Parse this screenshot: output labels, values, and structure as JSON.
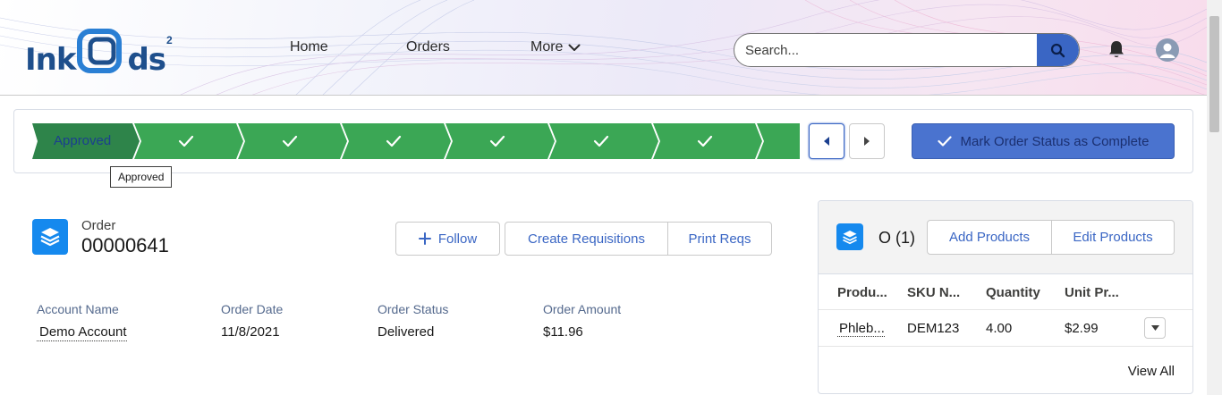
{
  "header": {
    "logo": {
      "text_left": "Ink",
      "text_right": "ds",
      "superscript": "2"
    },
    "nav": {
      "home": "Home",
      "orders": "Orders",
      "more": "More"
    },
    "search": {
      "placeholder": "Search..."
    },
    "icons": {
      "search": "search-icon",
      "bell": "bell-icon",
      "avatar": "user-avatar-icon",
      "more": "chevron-down-icon"
    }
  },
  "path": {
    "current_stage": "Approved",
    "completed_steps_shown": 7,
    "tooltip": "Approved",
    "mark_complete_label": "Mark Order Status as Complete",
    "colors": {
      "complete": "#3ba755",
      "current": "#2e844a",
      "button": "#4a73cf"
    }
  },
  "record": {
    "type_label": "Order",
    "number": "00000641",
    "actions": {
      "follow": "Follow",
      "create_requisitions": "Create Requisitions",
      "print_reqs": "Print Reqs"
    },
    "fields": [
      {
        "label": "Account Name",
        "value": "Demo Account",
        "link": true
      },
      {
        "label": "Order Date",
        "value": "11/8/2021",
        "link": false
      },
      {
        "label": "Order Status",
        "value": "Delivered",
        "link": false
      },
      {
        "label": "Order Amount",
        "value": "$11.96",
        "link": false
      }
    ]
  },
  "related": {
    "title": "O (1)",
    "add_label": "Add Products",
    "edit_label": "Edit Products",
    "columns": [
      "Produ...",
      "SKU N...",
      "Quantity",
      "Unit Pr..."
    ],
    "rows": [
      {
        "product": "Phleb...",
        "sku": "DEM123",
        "quantity": "4.00",
        "unit_price": "$2.99"
      }
    ],
    "view_all": "View All"
  }
}
